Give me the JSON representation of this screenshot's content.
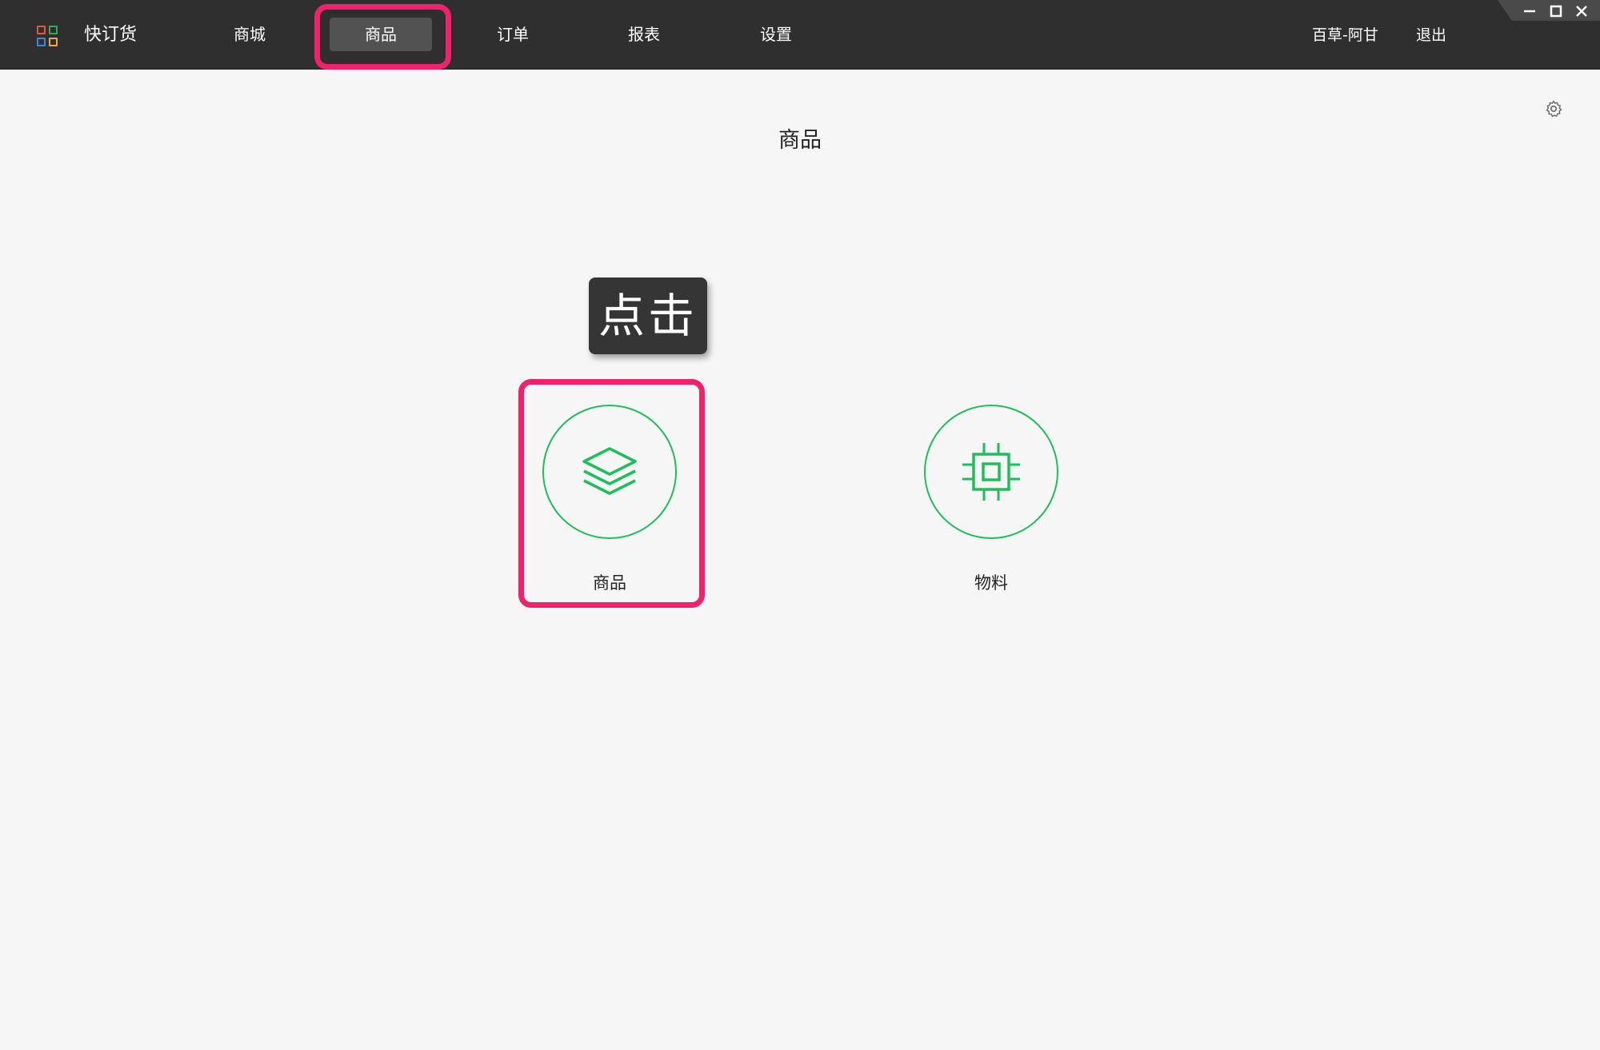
{
  "app": {
    "name": "快订货",
    "logo_colors": [
      "#e25a3c",
      "#3aa757",
      "#3b8ad9",
      "#f2a93b"
    ]
  },
  "nav": {
    "items": [
      {
        "label": "商城"
      },
      {
        "label": "商品"
      },
      {
        "label": "订单"
      },
      {
        "label": "报表"
      },
      {
        "label": "设置"
      }
    ],
    "active": "商品"
  },
  "header": {
    "user": "百草-阿甘",
    "logout": "退出"
  },
  "window_controls": {
    "icons": [
      "minimize-icon",
      "maximize-icon",
      "close-icon"
    ]
  },
  "page": {
    "title": "商品",
    "settings_icon": "gear-icon"
  },
  "tooltip": {
    "text": "点击"
  },
  "tiles": [
    {
      "label": "商品",
      "icon": "layers-icon"
    },
    {
      "label": "物料",
      "icon": "chip-icon"
    }
  ],
  "colors": {
    "topbar": "#2f2f2f",
    "accent_green": "#1ebe5a",
    "highlight": "#f0226b",
    "background": "#f6f6f6"
  }
}
